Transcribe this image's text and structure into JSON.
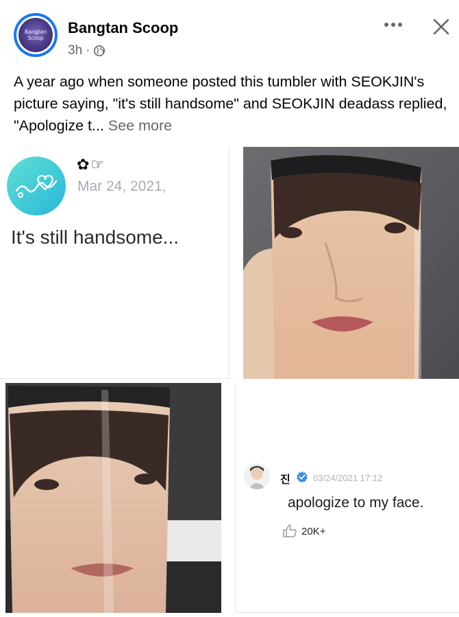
{
  "post": {
    "page_name": "Bangtan Scoop",
    "time": "3h",
    "separator": "·",
    "avatar_text_line1": "Bangtan",
    "avatar_text_line2": "Scoop",
    "caption": "A year ago when someone posted this tumbler with SEOKJIN's picture saying, \"it's still handsome\" and SEOKJIN deadass replied, \"Apologize t...",
    "see_more": "See more"
  },
  "tile1": {
    "user_glyph": "✿☞",
    "date": "Mar 24, 2021,",
    "quote": "It's still handsome..."
  },
  "tile4": {
    "name": "진",
    "date": "03/24/2021 17:12",
    "reply": "apologize to my face.",
    "likes": "20K+"
  },
  "icons": {
    "more": "more-options-icon",
    "close": "close-icon",
    "globe": "globe-icon",
    "verified": "verified-badge-icon",
    "like": "thumbs-up-icon"
  },
  "colors": {
    "brand_blue": "#1877f2",
    "secondary_text": "#65676b",
    "weverse_teal": "#3ccad8"
  }
}
